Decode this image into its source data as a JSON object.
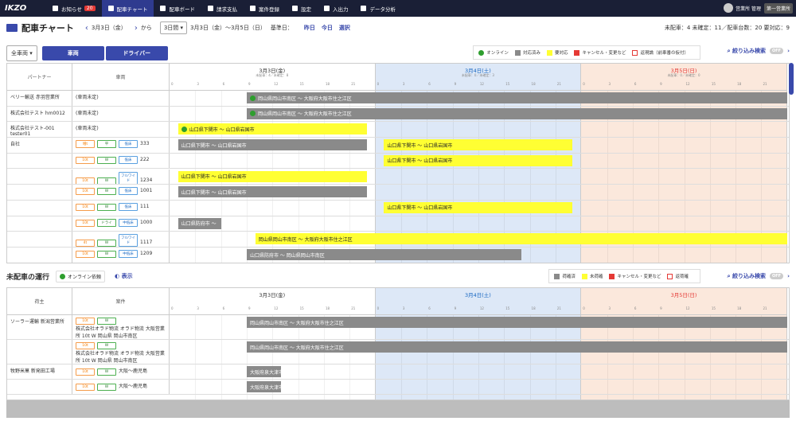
{
  "nav": {
    "logo": "IKZO",
    "items": [
      {
        "label": "お知らせ",
        "badge": "20"
      },
      {
        "label": "配車チャート"
      },
      {
        "label": "配車ボード"
      },
      {
        "label": "請求支払"
      },
      {
        "label": "案件登録"
      },
      {
        "label": "設定"
      },
      {
        "label": "入出力"
      },
      {
        "label": "データ分析"
      }
    ],
    "user": "営業所 管理",
    "user_btn": "第一営業所"
  },
  "header": {
    "title": "配車チャート",
    "date": "3月3日（金）",
    "from": "から",
    "period": "3日間",
    "range": "3月3日（金）～3月5日（日）",
    "base": "基準日：",
    "yesterday": "昨日",
    "today": "今日",
    "select": "選択",
    "stats": "未配車：4 未確定：11／配車台数：20 要対応：9"
  },
  "toolbar": {
    "vehicle_select": "全車両",
    "btn_vehicle": "車両",
    "btn_driver": "ドライバー",
    "filter": "絞り込み検索",
    "off": "OFF"
  },
  "legend": [
    {
      "label": "オンライン",
      "color": "#2e9e2e"
    },
    {
      "label": "対応済み",
      "color": "#8a8a8a"
    },
    {
      "label": "要対応",
      "color": "#ffff33"
    },
    {
      "label": "キャンセル・変更など",
      "color": "#e53935"
    },
    {
      "label": "返現論（前車番の仮付）",
      "color": "#ffffff"
    }
  ],
  "chart": {
    "col_partner": "パートナー",
    "col_vehicle": "車両",
    "days": [
      {
        "title": "3月3日(金)",
        "sub": "未配車：4／未確定：8"
      },
      {
        "title": "3月4日(土)",
        "sub": "未配車：0／未確定：3"
      },
      {
        "title": "3月5日(日)",
        "sub": "未配車：0／未確定：0"
      }
    ],
    "hours": [
      "0",
      "3",
      "6",
      "9",
      "12",
      "15",
      "18",
      "21"
    ]
  },
  "rows": [
    {
      "partner": "ベリー輸送 赤羽営業所",
      "vehicle": "(車両未定)",
      "tags": [],
      "bars": [
        {
          "label": "岡山県岡山市南区 ～ 大阪府大阪市住之江区",
          "color": "gray",
          "start": 9,
          "end": 72,
          "online": true
        }
      ]
    },
    {
      "partner": "株式会社テスト hm0012",
      "vehicle": "(車両未定)",
      "tags": [],
      "bars": [
        {
          "label": "岡山県岡山市南区 ～ 大阪府大阪市住之江区",
          "color": "gray",
          "start": 9,
          "end": 72,
          "online": true
        }
      ]
    },
    {
      "partner": "株式会社テスト-001 tester01",
      "vehicle": "(車両未定)",
      "tags": [],
      "bars": [
        {
          "label": "山口県下関市 ～ 山口県岩国市",
          "color": "yel",
          "start": 1,
          "end": 23,
          "online": true
        }
      ]
    },
    {
      "partner": "自社",
      "vehicle": "333",
      "tags": [
        {
          "t": "増t",
          "c": "to"
        },
        {
          "t": "平",
          "c": "tg"
        },
        {
          "t": "低床",
          "c": "tb2"
        }
      ],
      "bars": [
        {
          "label": "山口県下関市 ～ 山口県岩国市",
          "color": "gray",
          "start": 1,
          "end": 23
        },
        {
          "label": "山口県下関市 ～ 山口県岩国市",
          "color": "yel",
          "start": 25,
          "end": 47
        }
      ]
    },
    {
      "partner": "",
      "vehicle": "222",
      "tags": [
        {
          "t": "10t",
          "c": "to"
        },
        {
          "t": "W",
          "c": "tg"
        },
        {
          "t": "低床",
          "c": "tb2"
        }
      ],
      "bars": [
        {
          "label": "山口県下関市 ～ 山口県岩国市",
          "color": "yel",
          "start": 25,
          "end": 47
        }
      ]
    },
    {
      "partner": "",
      "vehicle": "1234",
      "tags": [
        {
          "t": "10t",
          "c": "to"
        },
        {
          "t": "W",
          "c": "tg"
        },
        {
          "t": "フルワイド",
          "c": "tb2"
        }
      ],
      "bars": [
        {
          "label": "山口県下関市 ～ 山口県岩国市",
          "color": "yel",
          "start": 1,
          "end": 23
        }
      ]
    },
    {
      "partner": "",
      "vehicle": "1001",
      "tags": [
        {
          "t": "10t",
          "c": "to"
        },
        {
          "t": "W",
          "c": "tg"
        },
        {
          "t": "低床",
          "c": "tb2"
        }
      ],
      "bars": [
        {
          "label": "山口県下関市 ～ 山口県岩国市",
          "color": "gray",
          "start": 1,
          "end": 23
        }
      ]
    },
    {
      "partner": "",
      "vehicle": "111",
      "tags": [
        {
          "t": "10t",
          "c": "to"
        },
        {
          "t": "W",
          "c": "tg"
        },
        {
          "t": "低床",
          "c": "tb2"
        }
      ],
      "bars": [
        {
          "label": "山口県下関市 ～ 山口県岩国市",
          "color": "yel",
          "start": 25,
          "end": 47
        }
      ]
    },
    {
      "partner": "",
      "vehicle": "1000",
      "tags": [
        {
          "t": "10t",
          "c": "to"
        },
        {
          "t": "ドライ",
          "c": "tg"
        },
        {
          "t": "中低床",
          "c": "tb2"
        }
      ],
      "bars": [
        {
          "label": "山口県防府市 ～",
          "color": "gray",
          "start": 1,
          "end": 6
        }
      ]
    },
    {
      "partner": "",
      "vehicle": "1117",
      "tags": [
        {
          "t": "4t",
          "c": "to"
        },
        {
          "t": "W",
          "c": "tg"
        },
        {
          "t": "フルワイド",
          "c": "tb2"
        }
      ],
      "bars": [
        {
          "label": "岡山県岡山市南区 ～ 大阪府大阪市住之江区",
          "color": "yel",
          "start": 10,
          "end": 72
        }
      ]
    },
    {
      "partner": "",
      "vehicle": "1209",
      "tags": [
        {
          "t": "10t",
          "c": "to"
        },
        {
          "t": "W",
          "c": "tg"
        },
        {
          "t": "中低床",
          "c": "tb2"
        }
      ],
      "bars": [
        {
          "label": "山口県防府市 ～ 岡山県岡山市南区",
          "color": "gray",
          "start": 9,
          "end": 41
        }
      ]
    }
  ],
  "unassigned": {
    "title": "未配車の運行",
    "online_label": "オンライン依頼",
    "show": "表示",
    "legend": [
      {
        "label": "荷確済",
        "color": "#8a8a8a"
      },
      {
        "label": "未荷確",
        "color": "#ffff33"
      },
      {
        "label": "キャンセル・変更など",
        "color": "#e53935"
      },
      {
        "label": "返荷確",
        "color": "#ffffff"
      }
    ],
    "filter": "絞り込み検索",
    "off": "OFF",
    "col_shipper": "荷主",
    "col_case": "案件",
    "rows": [
      {
        "shipper": "ソーラー運輸 新潟営業所",
        "tags": [
          "10t",
          "W"
        ],
        "case": "株式会社オラド物流 オラド物流 大阪営業所 10t W 岡山県 岡山市南区",
        "bar": "岡山県岡山市南区 ～ 大阪府大阪市住之江区",
        "start": 9,
        "end": 72
      },
      {
        "shipper": "",
        "tags": [
          "10t",
          "W"
        ],
        "case": "株式会社オラド物流 オラド物流 大阪営業所 10t W 岡山県 岡山市南区",
        "bar": "岡山県岡山市南区 ～ 大阪府大阪市住之江区",
        "start": 9,
        "end": 72
      },
      {
        "shipper": "牧野米菓 新発田工場",
        "tags": [
          "10t",
          "W"
        ],
        "case": "大阪～鹿児島",
        "bar": "大阪府泉大津市",
        "start": 9,
        "end": 13
      },
      {
        "shipper": "",
        "tags": [
          "10t",
          "W"
        ],
        "case": "大阪～鹿児島",
        "bar": "大阪府泉大津市",
        "start": 9,
        "end": 13
      }
    ]
  }
}
